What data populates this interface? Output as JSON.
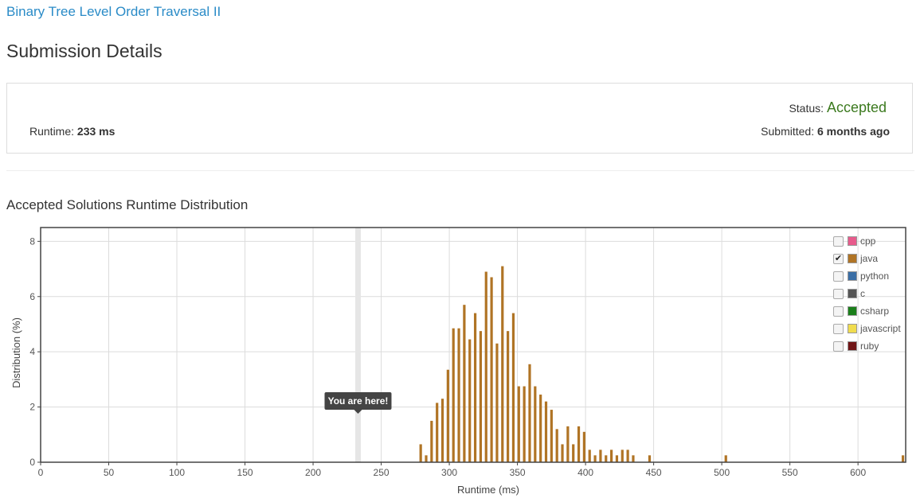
{
  "header": {
    "problem_title": "Binary Tree Level Order Traversal II",
    "page_title": "Submission Details"
  },
  "submission": {
    "runtime_label": "Runtime:",
    "runtime_value": "233 ms",
    "status_label": "Status:",
    "status_value": "Accepted",
    "submitted_label": "Submitted:",
    "submitted_value": "6 months ago"
  },
  "section_title": "Accepted Solutions Runtime Distribution",
  "tooltip": "You are here!",
  "legend": [
    {
      "label": "cpp",
      "color": "#e75b8c",
      "checked": false
    },
    {
      "label": "java",
      "color": "#b07425",
      "checked": true
    },
    {
      "label": "python",
      "color": "#3a6ea5",
      "checked": false
    },
    {
      "label": "c",
      "color": "#555555",
      "checked": false
    },
    {
      "label": "csharp",
      "color": "#1a7f1a",
      "checked": false
    },
    {
      "label": "javascript",
      "color": "#f0dc4e",
      "checked": false
    },
    {
      "label": "ruby",
      "color": "#701516",
      "checked": false
    }
  ],
  "chart_data": {
    "type": "bar",
    "xlabel": "Runtime (ms)",
    "ylabel": "Distribution (%)",
    "xlim": [
      0,
      635
    ],
    "ylim": [
      0,
      8.5
    ],
    "xticks": [
      0,
      50,
      100,
      150,
      200,
      250,
      300,
      350,
      400,
      450,
      500,
      550,
      600
    ],
    "yticks": [
      0,
      2,
      4,
      6,
      8
    ],
    "grid": true,
    "legend_position": "top-right",
    "marker_runtime": 233,
    "bar_color": "#b07425",
    "series": [
      {
        "name": "java",
        "x": [
          279,
          283,
          287,
          291,
          295,
          299,
          303,
          307,
          311,
          315,
          319,
          323,
          327,
          331,
          335,
          339,
          343,
          347,
          351,
          355,
          359,
          363,
          367,
          371,
          375,
          379,
          383,
          387,
          391,
          395,
          399,
          403,
          407,
          411,
          415,
          419,
          423,
          427,
          431,
          435,
          447,
          503,
          633
        ],
        "values": [
          0.65,
          0.25,
          1.5,
          2.15,
          2.3,
          3.35,
          4.85,
          4.85,
          5.7,
          4.45,
          5.4,
          4.75,
          6.9,
          6.7,
          4.3,
          7.1,
          4.75,
          5.4,
          2.75,
          2.75,
          3.55,
          2.75,
          2.45,
          2.2,
          1.9,
          1.2,
          0.65,
          1.3,
          0.65,
          1.3,
          1.1,
          0.45,
          0.25,
          0.45,
          0.25,
          0.45,
          0.25,
          0.45,
          0.45,
          0.25,
          0.25,
          0.25,
          0.25
        ]
      }
    ]
  }
}
